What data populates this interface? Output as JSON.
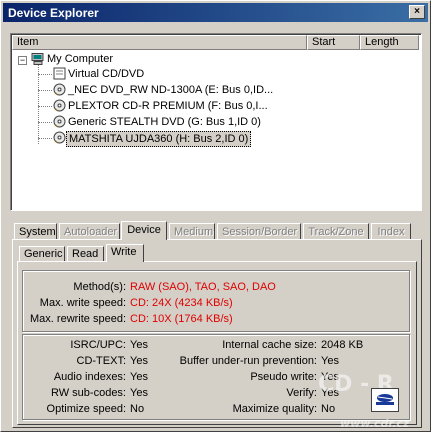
{
  "window": {
    "title": "Device Explorer",
    "close_label": "×"
  },
  "list": {
    "columns": [
      "Item",
      "Start",
      "Length"
    ],
    "root": {
      "label": "My Computer",
      "expander": "−"
    },
    "devices": [
      {
        "label": "Virtual CD/DVD",
        "icon": "virtual-drive-icon"
      },
      {
        "label": "_NEC DVD_RW ND-1300A (E: Bus 0,ID...",
        "icon": "optical-drive-icon"
      },
      {
        "label": "PLEXTOR CD-R   PREMIUM (F: Bus 0,I...",
        "icon": "optical-drive-icon"
      },
      {
        "label": "Generic STEALTH DVD (G: Bus 1,ID 0)",
        "icon": "optical-drive-icon"
      },
      {
        "label": "MATSHITA UJDA360 (H: Bus 2,ID 0)",
        "icon": "optical-drive-icon"
      }
    ]
  },
  "tabs": [
    {
      "label": "System",
      "state": "normal"
    },
    {
      "label": "Autoloader",
      "state": "disabled"
    },
    {
      "label": "Device",
      "state": "active"
    },
    {
      "label": "Medium",
      "state": "disabled"
    },
    {
      "label": "Session/Border",
      "state": "disabled"
    },
    {
      "label": "Track/Zone",
      "state": "disabled"
    },
    {
      "label": "Index",
      "state": "disabled"
    }
  ],
  "subtabs": [
    {
      "label": "Generic",
      "state": "normal"
    },
    {
      "label": "Read",
      "state": "normal"
    },
    {
      "label": "Write",
      "state": "active"
    }
  ],
  "write": {
    "methods_label": "Method(s):",
    "methods_value": "RAW (SAO), TAO, SAO, DAO",
    "max_write_label": "Max. write speed:",
    "max_write_value": "CD: 24X (4234 KB/s)",
    "max_rewrite_label": "Max. rewrite speed:",
    "max_rewrite_value": "CD: 10X (1764 KB/s)"
  },
  "features_left": [
    {
      "label": "ISRC/UPC:",
      "value": "Yes"
    },
    {
      "label": "CD-TEXT:",
      "value": "Yes"
    },
    {
      "label": "Audio indexes:",
      "value": "Yes"
    },
    {
      "label": "RW sub-codes:",
      "value": "Yes"
    },
    {
      "label": "Optimize speed:",
      "value": "No"
    }
  ],
  "features_right": [
    {
      "label": "Internal cache size:",
      "value": "2048 KB"
    },
    {
      "label": "Buffer under-run prevention:",
      "value": "Yes"
    },
    {
      "label": "Pseudo write:",
      "value": "Yes"
    },
    {
      "label": "Verify:",
      "value": "Yes"
    },
    {
      "label": "Maximize quality:",
      "value": "No"
    }
  ],
  "watermark": {
    "big": "CD - R",
    "small": "www.cdr.cz"
  },
  "colors": {
    "accent_red": "#e00000",
    "title_start": "#0a246a",
    "title_end": "#3a6ea5",
    "face": "#d4d0c8"
  }
}
